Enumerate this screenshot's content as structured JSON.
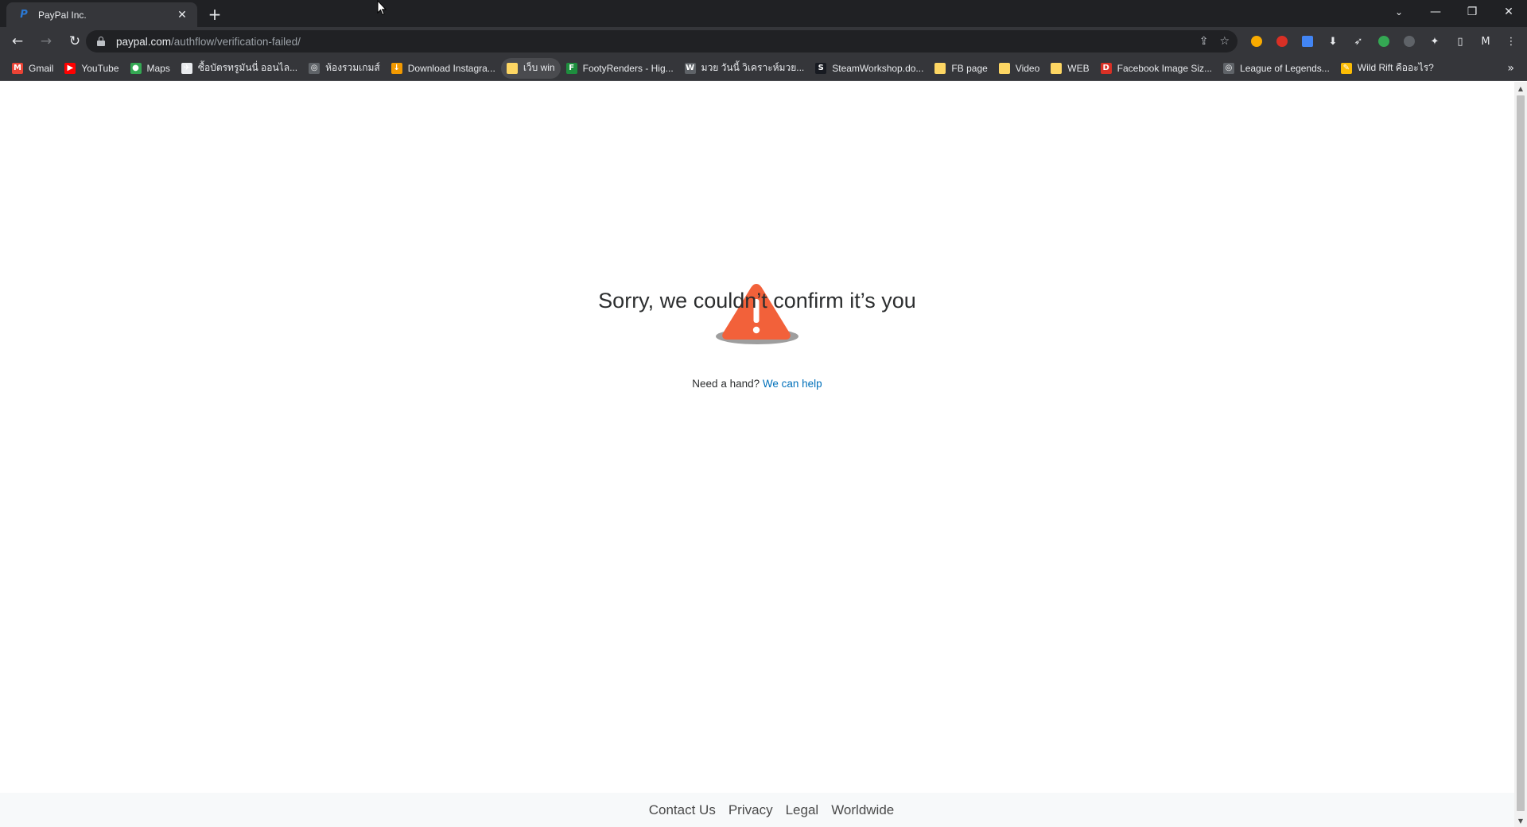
{
  "browser": {
    "tab": {
      "title": "PayPal Inc.",
      "favicon": "P"
    },
    "url": {
      "host": "paypal.com",
      "path": "/authflow/verification-failed/"
    },
    "bookmarks": [
      {
        "label": "Gmail",
        "icon": "gmail-icon",
        "color": "#ea4335",
        "glyph": "M"
      },
      {
        "label": "YouTube",
        "icon": "youtube-icon",
        "color": "#ff0000",
        "glyph": "▶"
      },
      {
        "label": "Maps",
        "icon": "maps-icon",
        "color": "#34a853",
        "glyph": "●"
      },
      {
        "label": "ซื้อบัตรทรูมันนี่ ออนไล...",
        "icon": "truemoney-icon",
        "color": "#e8eaed",
        "glyph": "✈"
      },
      {
        "label": "ห้องรวมเกมส์",
        "icon": "globe-icon",
        "color": "#5f6368",
        "glyph": "◎"
      },
      {
        "label": "Download Instagra...",
        "icon": "download-icon",
        "color": "#f29900",
        "glyph": "↓"
      },
      {
        "label": "เว็บ win",
        "icon": "folder-icon",
        "color": "#fdd663",
        "glyph": ""
      },
      {
        "label": "FootyRenders - Hig...",
        "icon": "footyrenders-icon",
        "color": "#1e8e3e",
        "glyph": "F"
      },
      {
        "label": "มวย วันนี้ วิเคราะห์มวย...",
        "icon": "wordpress-icon",
        "color": "#5f6368",
        "glyph": "W"
      },
      {
        "label": "SteamWorkshop.do...",
        "icon": "steam-icon",
        "color": "#171a21",
        "glyph": "S"
      },
      {
        "label": "FB page",
        "icon": "folder-icon",
        "color": "#fdd663",
        "glyph": ""
      },
      {
        "label": "Video",
        "icon": "folder-icon",
        "color": "#fdd663",
        "glyph": ""
      },
      {
        "label": "WEB",
        "icon": "folder-icon",
        "color": "#fdd663",
        "glyph": ""
      },
      {
        "label": "Facebook Image Siz...",
        "icon": "d-icon",
        "color": "#d93025",
        "glyph": "D"
      },
      {
        "label": "League of Legends...",
        "icon": "globe-icon",
        "color": "#5f6368",
        "glyph": "◎"
      },
      {
        "label": "Wild Rift คืออะไร?",
        "icon": "wildrift-icon",
        "color": "#fbbc04",
        "glyph": "✎"
      }
    ]
  },
  "page": {
    "headline": "Sorry, we couldn’t confirm it’s you",
    "help_prefix": "Need a hand?",
    "help_link": "We can help",
    "footer": [
      "Contact Us",
      "Privacy",
      "Legal",
      "Worldwide"
    ]
  },
  "colors": {
    "warning": "#f2613a",
    "link": "#0070ba",
    "text": "#2c2e2f"
  }
}
